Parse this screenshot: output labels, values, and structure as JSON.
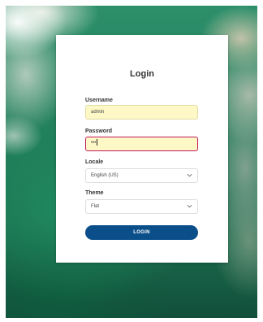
{
  "login": {
    "title": "Login",
    "username": {
      "label": "Username",
      "value": "admin"
    },
    "password": {
      "label": "Password",
      "masked_value": "•••"
    },
    "locale": {
      "label": "Locale",
      "selected": "English (US)"
    },
    "theme": {
      "label": "Theme",
      "selected": "Flat"
    },
    "submit_label": "LOGIN"
  },
  "icons": {
    "locale_dropdown": "chevron-down-icon",
    "theme_dropdown": "chevron-down-icon"
  },
  "colors": {
    "button": "#0b4f8a",
    "autofill_bg": "#fdf8c5",
    "focus_border": "#c2185b"
  }
}
